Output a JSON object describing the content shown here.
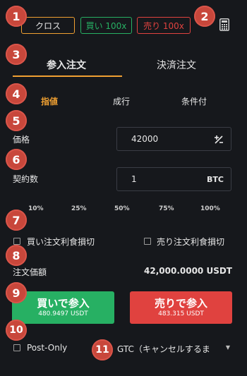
{
  "margin_mode": {
    "label": "クロス"
  },
  "leverage": {
    "buy_label": "買い 100x",
    "sell_label": "売り 100x"
  },
  "tabs": [
    {
      "label": "参入注文",
      "active": true
    },
    {
      "label": "決済注文",
      "active": false
    }
  ],
  "order_types": [
    {
      "label": "指値",
      "active": true
    },
    {
      "label": "成行",
      "active": false
    },
    {
      "label": "条件付",
      "active": false
    }
  ],
  "price": {
    "label": "価格",
    "value": "42000"
  },
  "quantity": {
    "label": "契約数",
    "value": "1",
    "unit": "BTC"
  },
  "percent_options": [
    "10%",
    "25%",
    "50%",
    "75%",
    "100%"
  ],
  "tpsl": {
    "buy_label": "買い注文利食損切",
    "sell_label": "売り注文利食損切"
  },
  "order_value": {
    "label": "注文価額",
    "value": "42,000.0000 USDT"
  },
  "buy_button": {
    "label": "買いで参入",
    "amount": "480.9497 USDT"
  },
  "sell_button": {
    "label": "売りで参入",
    "amount": "483.315 USDT"
  },
  "post_only": {
    "label": "Post-Only"
  },
  "time_in_force": {
    "value": "GTC（キャンセルするま"
  },
  "annotations": [
    "1",
    "2",
    "3",
    "4",
    "5",
    "6",
    "7",
    "8",
    "9",
    "10",
    "11"
  ],
  "colors": {
    "background": "#16181c",
    "accent": "#f0a032",
    "buy": "#27b063",
    "sell": "#e0423f",
    "badge": "#c8473b"
  }
}
